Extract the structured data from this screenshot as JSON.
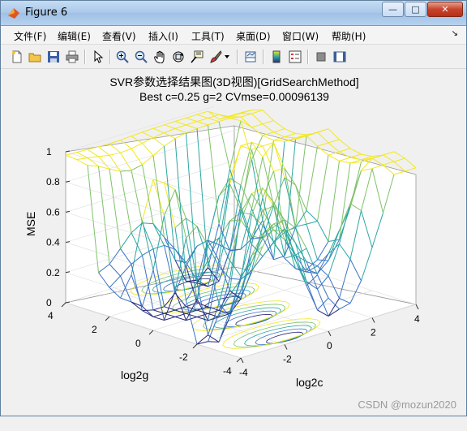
{
  "window": {
    "title": "Figure 6",
    "buttons": {
      "minimize": "—",
      "maximize": "□",
      "close": "✕"
    }
  },
  "menu": {
    "items": [
      "文件(F)",
      "编辑(E)",
      "查看(V)",
      "插入(I)",
      "工具(T)",
      "桌面(D)",
      "窗口(W)",
      "帮助(H)"
    ],
    "overflow": "↘"
  },
  "toolbar": {
    "icons": [
      "new-figure-icon",
      "open-file-icon",
      "save-icon",
      "print-icon",
      "select-arrow-icon",
      "zoom-in-icon",
      "zoom-out-icon",
      "pan-hand-icon",
      "rotate-3d-icon",
      "data-cursor-icon",
      "brush-icon",
      "brush-dropdown-icon",
      "link-plot-icon",
      "colorbar-icon",
      "legend-icon",
      "hide-plot-tools-icon",
      "show-plot-tools-icon"
    ]
  },
  "plot": {
    "title_line1": "SVR参数选择结果图(3D视图)[GridSearchMethod]",
    "title_line2": "Best c=0.25 g=2 CVmse=0.00096139",
    "zlabel": "MSE",
    "xlabel": "log2c",
    "ylabel": "log2g",
    "zticks": [
      "0",
      "0.2",
      "0.4",
      "0.6",
      "0.8",
      "1"
    ],
    "xticks": [
      "-4",
      "-2",
      "0",
      "2",
      "4"
    ],
    "yticks": [
      "-4",
      "-2",
      "0",
      "2",
      "4"
    ],
    "colors": {
      "high": "#f2e81f",
      "mid_high": "#7fc26b",
      "mid": "#2ba6a3",
      "mid_low": "#3b74c6",
      "low": "#282a7a"
    }
  },
  "chart_data": {
    "type": "surface",
    "title": "SVR参数选择结果图(3D视图)[GridSearchMethod]",
    "subtitle": "Best c=0.25 g=2 CVmse=0.00096139",
    "xlabel": "log2c",
    "ylabel": "log2g",
    "zlabel": "MSE",
    "xlim": [
      -4,
      4
    ],
    "ylim": [
      -4,
      4
    ],
    "zlim": [
      0,
      1
    ],
    "grid": true,
    "best_point": {
      "log2c": -2,
      "log2g": 1,
      "c": 0.25,
      "g": 2,
      "mse": 0.00096139
    },
    "surface_summary": "MSE near 1 for high log2c/log2g edges, dips toward 0 in interior valleys; contour projection on floor plane"
  },
  "watermark": "CSDN @mozun2020"
}
